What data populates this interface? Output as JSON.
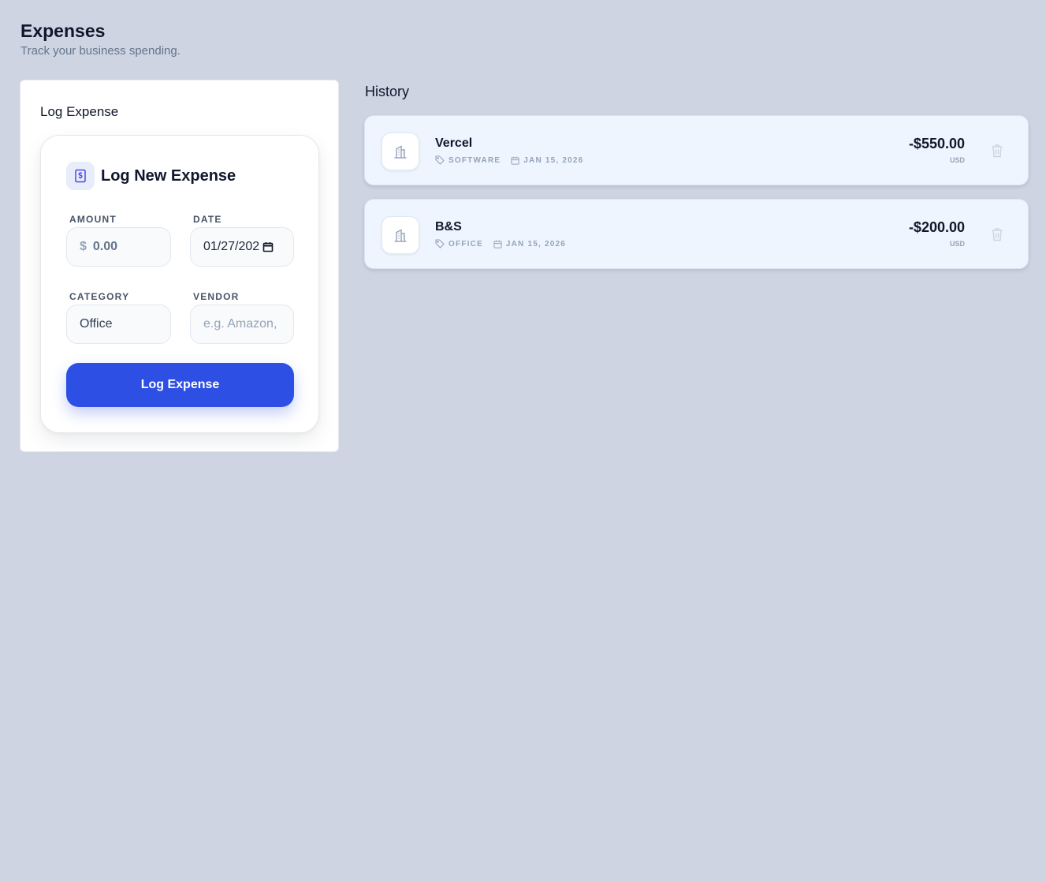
{
  "header": {
    "title": "Expenses",
    "subtitle": "Track your business spending."
  },
  "log_panel": {
    "title": "Log Expense",
    "form": {
      "heading": "Log New Expense",
      "heading_icon": "receipt-dollar-icon",
      "amount": {
        "label": "AMOUNT",
        "currency_symbol": "$",
        "placeholder": "0.00",
        "value": ""
      },
      "date": {
        "label": "DATE",
        "value": "01/27/202"
      },
      "category": {
        "label": "CATEGORY",
        "value": "Office"
      },
      "vendor": {
        "label": "VENDOR",
        "placeholder": "e.g. Amazon,",
        "value": ""
      },
      "submit_label": "Log Expense"
    }
  },
  "history": {
    "title": "History",
    "items": [
      {
        "vendor": "Vercel",
        "category": "SOFTWARE",
        "date": "JAN 15, 2026",
        "amount": "-$550.00",
        "currency": "USD",
        "icon": "building-icon"
      },
      {
        "vendor": "B&S",
        "category": "OFFICE",
        "date": "JAN 15, 2026",
        "amount": "-$200.00",
        "currency": "USD",
        "icon": "building-icon"
      }
    ]
  },
  "colors": {
    "background": "#ced4e2",
    "accent": "#2d4fe4",
    "card_item": "#eef5ff"
  }
}
